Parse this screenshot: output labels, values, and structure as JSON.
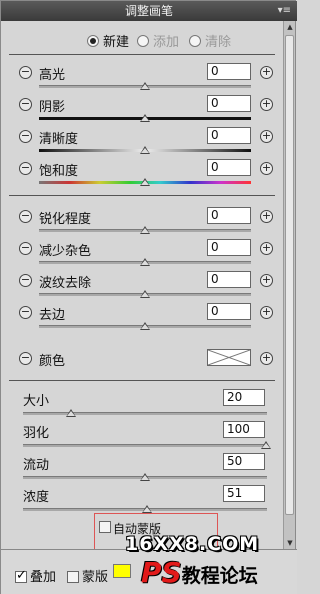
{
  "panel": {
    "title": "调整画笔",
    "menu_icon": "panel-menu-icon"
  },
  "modes": [
    {
      "label": "新建",
      "selected": true,
      "enabled": true
    },
    {
      "label": "添加",
      "selected": false,
      "enabled": false
    },
    {
      "label": "清除",
      "selected": false,
      "enabled": false
    }
  ],
  "group1": [
    {
      "label": "高光",
      "value": "0",
      "track": "plain"
    },
    {
      "label": "阴影",
      "value": "0",
      "track": "black"
    },
    {
      "label": "清晰度",
      "value": "0",
      "track": "gray-gradient"
    },
    {
      "label": "饱和度",
      "value": "0",
      "track": "saturation"
    }
  ],
  "group2": [
    {
      "label": "锐化程度",
      "value": "0"
    },
    {
      "label": "减少杂色",
      "value": "0"
    },
    {
      "label": "波纹去除",
      "value": "0"
    },
    {
      "label": "去边",
      "value": "0"
    }
  ],
  "color": {
    "label": "颜色",
    "swatch": "none"
  },
  "brush": [
    {
      "label": "大小",
      "value": "20"
    },
    {
      "label": "羽化",
      "value": "100"
    },
    {
      "label": "流动",
      "value": "50"
    },
    {
      "label": "浓度",
      "value": "51"
    }
  ],
  "auto_mask": {
    "label": "自动蒙版",
    "checked": false
  },
  "bottom": {
    "overlay_label": "叠加",
    "overlay_checked": true,
    "mask_label": "蒙版",
    "mask_checked": false,
    "mask_color": "#ffff00"
  },
  "watermark": {
    "line1": "16XX8.COM",
    "line2_ps": "PS",
    "line2_rest": "教程论坛"
  }
}
